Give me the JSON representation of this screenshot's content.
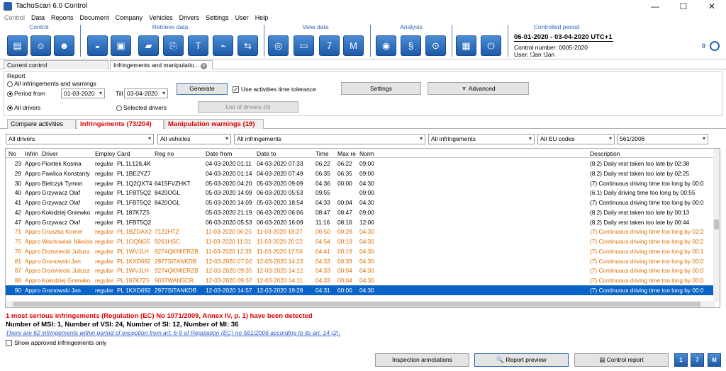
{
  "window": {
    "title": "TachoScan 6.0 Control"
  },
  "menu": [
    "Control",
    "Data",
    "Reports",
    "Document",
    "Company",
    "Vehicles",
    "Drivers",
    "Settings",
    "User",
    "Help"
  ],
  "ribbon": {
    "groups": {
      "control": "Control",
      "retrieve": "Retrieve data",
      "view": "View data",
      "analysis": "Analysis",
      "period_label": "Controlled period"
    },
    "period": "06-01-2020 - 03-04-2020 UTC+1",
    "control_number": "Control number: 0005-2020",
    "user": "User: !Jan !Jan",
    "counter": "0"
  },
  "doc_tabs": {
    "current": "Current control",
    "infr": "Infringements and manipulatio..."
  },
  "report": {
    "label": "Report",
    "all_infr": "All infringements and warnings",
    "period_from": "Period from",
    "from": "01-03-2020",
    "till_label": "Till",
    "till": "03-04-2020",
    "all_drivers": "All drivers",
    "selected_drivers": "Selected drivers",
    "generate": "Generate",
    "tolerance": "Use activities time tolerance",
    "settings": "Settings",
    "advanced": "Advanced",
    "list_drivers": "List of drivers (0)"
  },
  "sub_tabs": {
    "compare": "Compare activities",
    "infr": "Infringements (73/204)",
    "manip": "Manipulation warnings (19)"
  },
  "filters": {
    "drivers": "All drivers",
    "vehicles": "All vehicles",
    "infr1": "All infringements",
    "infr2": "All infringements",
    "eu": "All EU codes",
    "reg": "561/2006"
  },
  "columns": {
    "no": "No",
    "infr": "Infrin",
    "driver": "Driver",
    "employ": "Employ",
    "card": "Card",
    "reg": "Reg no",
    "from": "Date from",
    "to": "Date to",
    "time": "Time",
    "maxre": "Max re",
    "norm": "Norm",
    "desc": "Description"
  },
  "rows": [
    {
      "no": "23",
      "infr": "Appro",
      "driver": "Piontek Kosma",
      "employ": "regular",
      "card": "PL 1L12IL4K",
      "reg": "",
      "from": "04-03-2020 01:11",
      "to": "04-03-2020 07:33",
      "time": "06:22",
      "maxre": "06:22",
      "norm": "09:00",
      "desc": "(8.2) Daily rest taken too late by 02:38",
      "style": ""
    },
    {
      "no": "29",
      "infr": "Appro",
      "driver": "Pawlica Konstanty",
      "employ": "regular",
      "card": "PL 1BE2YZ7",
      "reg": "",
      "from": "04-03-2020 01:14",
      "to": "04-03-2020 07:49",
      "time": "06:35",
      "maxre": "06:35",
      "norm": "09:00",
      "desc": "(8.2) Daily rest taken too late by 02:25",
      "style": ""
    },
    {
      "no": "30",
      "infr": "Appro",
      "driver": "Bielczyk Tymon",
      "employ": "regular",
      "card": "PL 1Q2QXT4",
      "reg": "6415FVZHKT",
      "from": "05-03-2020 04:20",
      "to": "05-03-2020 09:09",
      "time": "04:36",
      "maxre": "00:00",
      "norm": "04:30",
      "desc": "(7) Continuous driving time too long by 00:0",
      "style": ""
    },
    {
      "no": "40",
      "infr": "Appro",
      "driver": "Grzywacz Olaf",
      "employ": "regular",
      "card": "PL 1FBT5Q2",
      "reg": "8420OGL",
      "from": "05-03-2020 14:09",
      "to": "06-03-2020 05:53",
      "time": "09:55",
      "maxre": "",
      "norm": "09:00",
      "desc": "(6.1) Daily driving time too long by 00:55",
      "style": ""
    },
    {
      "no": "41",
      "infr": "Appro",
      "driver": "Grzywacz Olaf",
      "employ": "regular",
      "card": "PL 1FBT5Q2",
      "reg": "8420OGL",
      "from": "05-03-2020 14:09",
      "to": "05-03-2020 18:54",
      "time": "04:33",
      "maxre": "00:04",
      "norm": "04:30",
      "desc": "(7) Continuous driving time too long by 00:0",
      "style": ""
    },
    {
      "no": "42",
      "infr": "Appro",
      "driver": "Kołodziej Gniewko",
      "employ": "regular",
      "card": "PL 187K7Z5",
      "reg": "",
      "from": "05-03-2020 21:19",
      "to": "06-03-2020 06:06",
      "time": "08:47",
      "maxre": "08:47",
      "norm": "09:00",
      "desc": "(8.2) Daily rest taken too late by 00:13",
      "style": ""
    },
    {
      "no": "47",
      "infr": "Appro",
      "driver": "Grzywacz Olaf",
      "employ": "regular",
      "card": "PL 1FBT5Q2",
      "reg": "",
      "from": "06-03-2020 05:53",
      "to": "06-03-2020 16:09",
      "time": "11:16",
      "maxre": "08:16",
      "norm": "12:00",
      "desc": "(8.2) Daily rest taken too late by 00:44",
      "style": ""
    },
    {
      "no": "71",
      "infr": "Appro",
      "driver": "Gruszka Kornel",
      "employ": "regular",
      "card": "PL 1BZDAX2",
      "reg": "7122HTZ",
      "from": "11-03-2020 06:25",
      "to": "11-03-2020 18:27",
      "time": "06:50",
      "maxre": "00:28",
      "norm": "04:30",
      "desc": "(7) Continuous driving time too long by 02:2",
      "style": "orange"
    },
    {
      "no": "75",
      "infr": "Appro",
      "driver": "Wachowiak Nikolas",
      "employ": "regular",
      "card": "PL 1OQNG5",
      "reg": "9261HSC",
      "from": "11-03-2020 11:31",
      "to": "11-03-2020 20:22",
      "time": "04:54",
      "maxre": "00:19",
      "norm": "04:30",
      "desc": "(7) Continuous driving time too long by 00:2",
      "style": "orange"
    },
    {
      "no": "76",
      "infr": "Appro",
      "driver": "Drzewiecki Juliusz",
      "employ": "regular",
      "card": "PL 1WVJLH",
      "reg": "9274QKMIERZB",
      "from": "11-03-2020 12:35",
      "to": "11-03-2020 17:56",
      "time": "04:41",
      "maxre": "00:19",
      "norm": "04:30",
      "desc": "(7) Continuous driving time too long by 00:1",
      "style": "orange"
    },
    {
      "no": "81",
      "infr": "Appro",
      "driver": "Gronowski Jan",
      "employ": "regular",
      "card": "PL 1KXD692",
      "reg": "2977SITANKDB",
      "from": "12-03-2020 07:02",
      "to": "12-03-2020 14:23",
      "time": "04:33",
      "maxre": "00:33",
      "norm": "04:30",
      "desc": "(7) Continuous driving time too long by 00:0",
      "style": "orange"
    },
    {
      "no": "87",
      "infr": "Appro",
      "driver": "Drzewiecki Juliusz",
      "employ": "regular",
      "card": "PL 1WVJLH",
      "reg": "9274QKMIERZB",
      "from": "12-03-2020 09:35",
      "to": "12-03-2020 14:12",
      "time": "04:33",
      "maxre": "00:04",
      "norm": "04:30",
      "desc": "(7) Continuous driving time too long by 00:0",
      "style": "orange"
    },
    {
      "no": "88",
      "infr": "Appro",
      "driver": "Kołodziej Gniewko",
      "employ": "regular",
      "card": "PL 187K7Z5",
      "reg": "9037WANSCR",
      "from": "12-03-2020 09:37",
      "to": "12-03-2020 14:11",
      "time": "04:33",
      "maxre": "00:04",
      "norm": "04:30",
      "desc": "(7) Continuous driving time too long by 00:0",
      "style": "orange"
    },
    {
      "no": "90",
      "infr": "Appro",
      "driver": "Gronowski Jan",
      "employ": "regular",
      "card": "PL 1KXD692",
      "reg": "2977SITANKDB",
      "from": "12-03-2020 14:57",
      "to": "12-03-2020 19:28",
      "time": "04:31",
      "maxre": "00:00",
      "norm": "04:30",
      "desc": "(7) Continuous driving time too long by 00:0",
      "style": "sel"
    }
  ],
  "messages": {
    "m1": "1 most serious infringements (Regulation (EC) No 1071/2009, Annex IV, p. 1) have been detected",
    "m2": "Number of MSI: 1, Number of VSI: 24, Number of SI: 12, Number of MI: 36",
    "m3": "There are 62 infringements within period of exception from art. 6-9 of Regulation (EC) no 561/2006 according to its art. 14 (2).",
    "m4": "Show approved infringements only"
  },
  "bottom": {
    "inspection": "Inspection annotations",
    "preview": "Report preview",
    "control_report": "Control report",
    "q1": "1",
    "q2": "7",
    "q3": "M"
  }
}
